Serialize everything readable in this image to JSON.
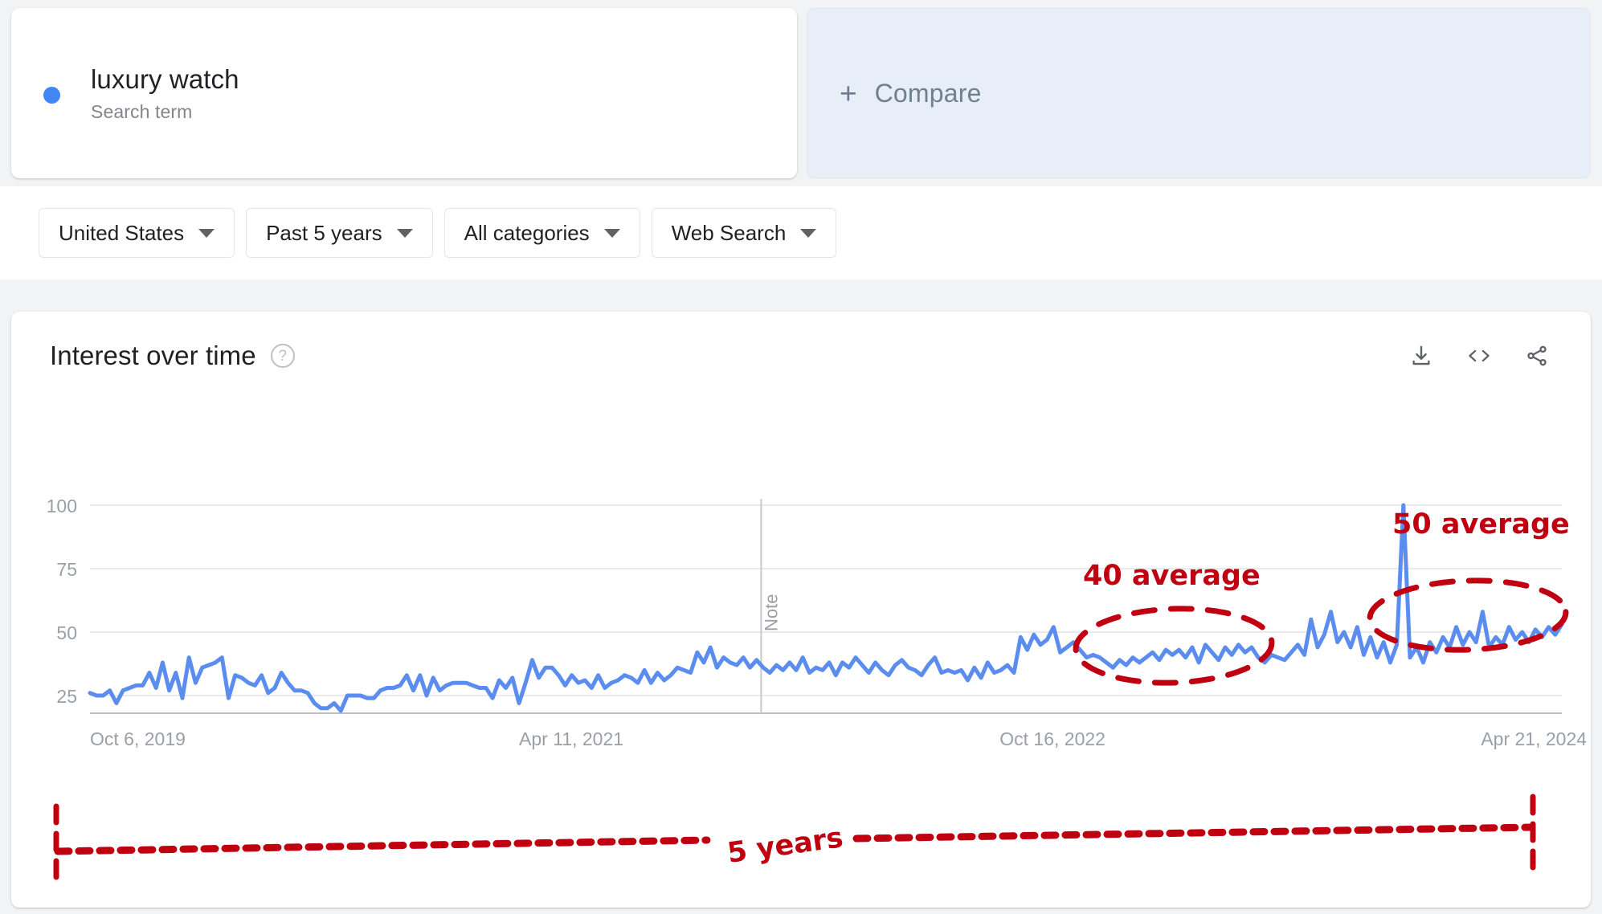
{
  "search_term": {
    "name": "luxury watch",
    "type_label": "Search term",
    "dot_color": "#4285f4"
  },
  "compare": {
    "plus": "+",
    "label": "Compare"
  },
  "filters": [
    {
      "label": "United States",
      "name": "region-filter"
    },
    {
      "label": "Past 5 years",
      "name": "time-range-filter"
    },
    {
      "label": "All categories",
      "name": "category-filter"
    },
    {
      "label": "Web Search",
      "name": "search-type-filter"
    }
  ],
  "card": {
    "title": "Interest over time",
    "help_glyph": "?",
    "actions": [
      {
        "name": "download-icon",
        "label": "download"
      },
      {
        "name": "embed-icon",
        "label": "embed"
      },
      {
        "name": "share-icon",
        "label": "share"
      }
    ]
  },
  "note_marker": {
    "label": "Note"
  },
  "annotations": {
    "avg_40": "40 average",
    "avg_50": "50 average",
    "duration": "5 years",
    "color": "#c00011"
  },
  "chart_data": {
    "type": "line",
    "title": "Interest over time",
    "xlabel": "",
    "ylabel": "",
    "ylim": [
      0,
      100
    ],
    "yticks": [
      25,
      50,
      75,
      100
    ],
    "grid": true,
    "legend": false,
    "line_color": "#5b8def",
    "xtick_labels": [
      "Oct 6, 2019",
      "Apr 11, 2021",
      "Oct 16, 2022",
      "Apr 21, 2024"
    ],
    "xtick_positions": [
      0,
      0.327,
      0.654,
      0.981
    ],
    "series": [
      {
        "name": "luxury watch",
        "values": [
          26,
          25,
          25,
          27,
          22,
          27,
          28,
          29,
          29,
          34,
          28,
          38,
          27,
          34,
          24,
          40,
          30,
          36,
          37,
          38,
          40,
          24,
          33,
          32,
          30,
          29,
          33,
          26,
          28,
          34,
          30,
          27,
          27,
          26,
          22,
          20,
          20,
          22,
          19,
          25,
          25,
          25,
          24,
          24,
          27,
          28,
          28,
          29,
          33,
          27,
          33,
          25,
          32,
          27,
          29,
          30,
          30,
          30,
          29,
          28,
          28,
          24,
          31,
          28,
          32,
          22,
          30,
          39,
          32,
          36,
          36,
          33,
          29,
          33,
          30,
          31,
          28,
          33,
          28,
          30,
          31,
          33,
          32,
          30,
          35,
          30,
          34,
          31,
          33,
          36,
          35,
          34,
          42,
          38,
          44,
          36,
          40,
          38,
          37,
          40,
          36,
          39,
          36,
          34,
          37,
          35,
          38,
          35,
          40,
          34,
          36,
          35,
          38,
          33,
          38,
          36,
          40,
          37,
          34,
          38,
          35,
          33,
          37,
          39,
          36,
          35,
          33,
          37,
          40,
          34,
          35,
          34,
          35,
          31,
          36,
          32,
          38,
          34,
          35,
          37,
          34,
          48,
          43,
          49,
          45,
          47,
          52,
          42,
          44,
          46,
          43,
          40,
          41,
          40,
          38,
          36,
          39,
          37,
          40,
          38,
          40,
          42,
          39,
          43,
          41,
          43,
          40,
          44,
          38,
          45,
          42,
          39,
          44,
          41,
          45,
          42,
          44,
          40,
          38,
          41,
          40,
          39,
          42,
          45,
          41,
          55,
          44,
          49,
          58,
          46,
          50,
          44,
          52,
          41,
          48,
          40,
          46,
          38,
          45,
          100,
          40,
          44,
          38,
          46,
          42,
          48,
          44,
          52,
          45,
          50,
          46,
          58,
          44,
          48,
          45,
          52,
          47,
          50,
          46,
          51,
          48,
          52,
          49,
          53
        ]
      }
    ],
    "highlights": [
      {
        "label": "40 average",
        "value": 40,
        "x_start": 0.64,
        "x_end": 0.79
      },
      {
        "label": "50 average",
        "value": 50,
        "x_start": 0.855,
        "x_end": 1.0
      }
    ],
    "markers": [
      {
        "label": "Note",
        "x": 0.456
      }
    ],
    "span_annotation": {
      "label": "5 years"
    }
  }
}
